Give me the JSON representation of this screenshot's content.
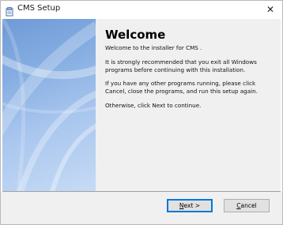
{
  "window": {
    "title": "CMS Setup",
    "close_glyph": "✕",
    "icon": "setup-app-icon"
  },
  "content": {
    "heading": "Welcome",
    "paragraphs": [
      "Welcome to the installer for CMS .",
      "It is strongly recommended that you exit all Windows programs before continuing with this installation.",
      "If you have any other programs running, please click Cancel, close the programs, and run this setup again.",
      "Otherwise, click Next to continue."
    ]
  },
  "buttons": {
    "next": {
      "mnemonic": "N",
      "rest": "ext >"
    },
    "cancel": {
      "mnemonic": "C",
      "rest": "ancel"
    }
  },
  "colors": {
    "banner_top": "#6f9ad6",
    "banner_bottom": "#c6dbf5",
    "panel_bg": "#f0f0f0",
    "focus_border": "#0078d7"
  }
}
